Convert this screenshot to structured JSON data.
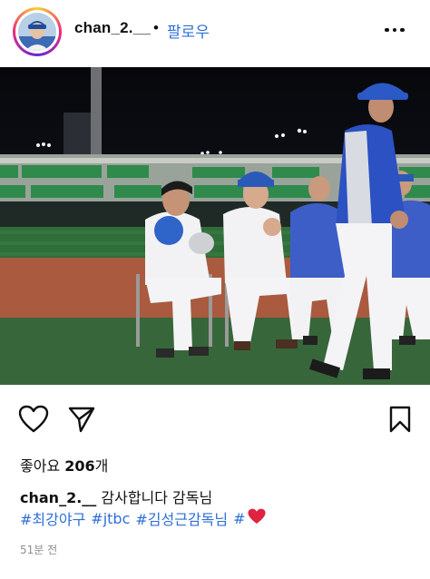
{
  "header": {
    "username": "chan_2.__",
    "separator": "•",
    "follow_label": "팔로우"
  },
  "post": {
    "likes_label": "좋아요",
    "likes_count": "206",
    "likes_suffix": "개",
    "caption_user": "chan_2.__",
    "caption_text": "감사합니다 감독님",
    "hashtags": [
      "#최강야구",
      "#jtbc",
      "#김성근감독님",
      "#"
    ],
    "time": "51분 전"
  },
  "icons": {
    "more": "more-horizontal-icon",
    "like": "heart-icon",
    "share": "send-icon",
    "save": "bookmark-icon",
    "emoji": "red-heart-emoji"
  },
  "colors": {
    "accent": "#2f6fd6",
    "heart_emoji": "#e0233f",
    "muted": "#8e8e8e"
  }
}
